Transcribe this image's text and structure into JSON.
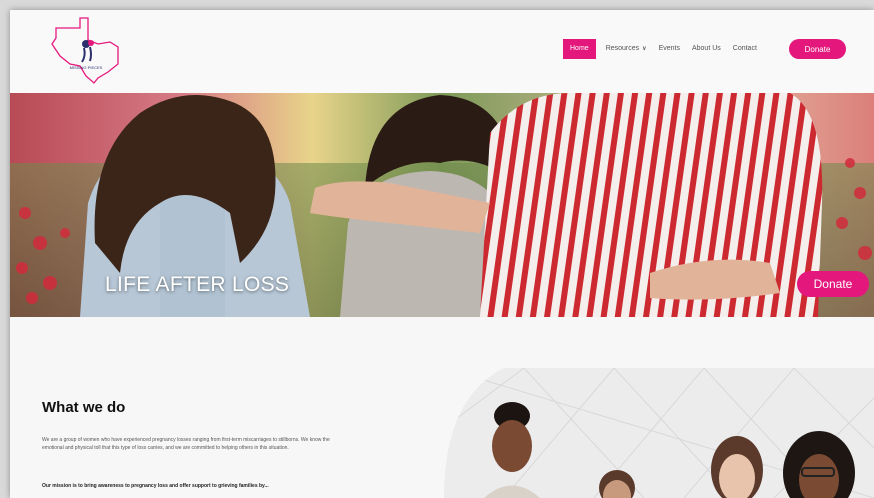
{
  "header": {
    "logo_text": "MISSING PIECES",
    "nav": [
      {
        "label": "Home",
        "active": true
      },
      {
        "label": "Resources",
        "dropdown": true
      },
      {
        "label": "Events"
      },
      {
        "label": "About Us"
      },
      {
        "label": "Contact"
      }
    ],
    "donate_label": "Donate"
  },
  "hero": {
    "title": "LIFE AFTER LOSS",
    "donate_label": "Donate"
  },
  "what_we_do": {
    "heading": "What we do",
    "body": "We are a group of women who have experienced pregnancy losses ranging from first-term miscarriages to stillborns. We know the emotional and physical toll that this type of loss carries, and we are committed to helping others in this situation.",
    "mission": "Our mission is to bring awareness to pregnancy loss and offer support to grieving families by..."
  },
  "colors": {
    "accent": "#e4187c",
    "background": "#f7f7f8"
  },
  "icons": {
    "logo": "texas-outline-logo",
    "dropdown": "chevron-down-icon"
  }
}
